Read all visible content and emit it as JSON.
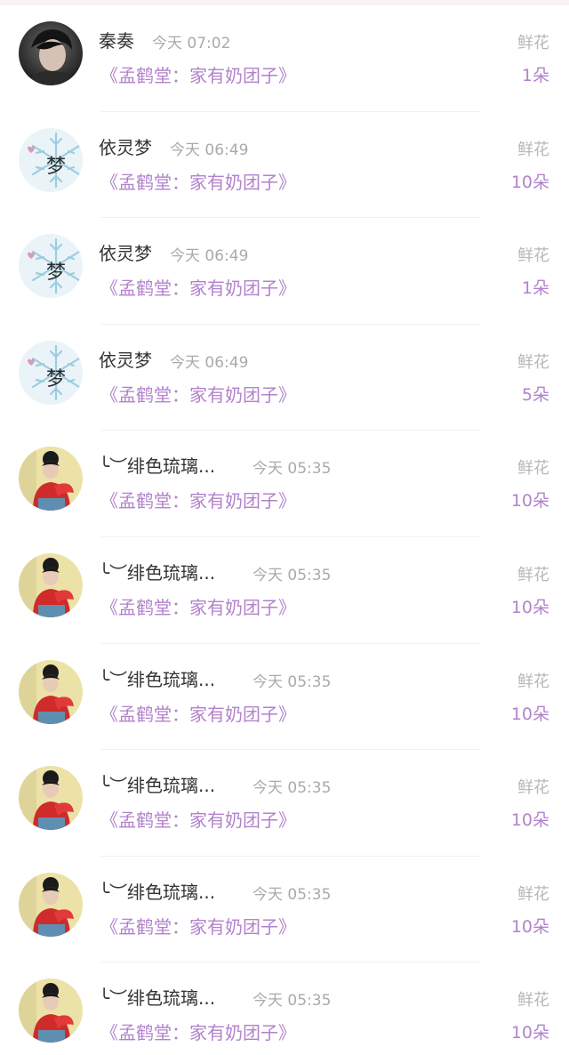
{
  "records": [
    {
      "user": "秦奏",
      "time": "今天 07:02",
      "book": "《孟鹤堂：家有奶团子》",
      "gift": "鲜花",
      "count": "1朵",
      "avatar": "photo-portrait"
    },
    {
      "user": "依灵梦",
      "time": "今天 06:49",
      "book": "《孟鹤堂：家有奶团子》",
      "gift": "鲜花",
      "count": "10朵",
      "avatar": "snowflake-meng"
    },
    {
      "user": "依灵梦",
      "time": "今天 06:49",
      "book": "《孟鹤堂：家有奶团子》",
      "gift": "鲜花",
      "count": "1朵",
      "avatar": "snowflake-meng"
    },
    {
      "user": "依灵梦",
      "time": "今天 06:49",
      "book": "《孟鹤堂：家有奶团子》",
      "gift": "鲜花",
      "count": "5朵",
      "avatar": "snowflake-meng"
    },
    {
      "user": "╰︶绯色琉璃...",
      "time": "今天 05:35",
      "book": "《孟鹤堂：家有奶团子》",
      "gift": "鲜花",
      "count": "10朵",
      "avatar": "girl-red"
    },
    {
      "user": "╰︶绯色琉璃...",
      "time": "今天 05:35",
      "book": "《孟鹤堂：家有奶团子》",
      "gift": "鲜花",
      "count": "10朵",
      "avatar": "girl-red"
    },
    {
      "user": "╰︶绯色琉璃...",
      "time": "今天 05:35",
      "book": "《孟鹤堂：家有奶团子》",
      "gift": "鲜花",
      "count": "10朵",
      "avatar": "girl-red"
    },
    {
      "user": "╰︶绯色琉璃...",
      "time": "今天 05:35",
      "book": "《孟鹤堂：家有奶团子》",
      "gift": "鲜花",
      "count": "10朵",
      "avatar": "girl-red"
    },
    {
      "user": "╰︶绯色琉璃...",
      "time": "今天 05:35",
      "book": "《孟鹤堂：家有奶团子》",
      "gift": "鲜花",
      "count": "10朵",
      "avatar": "girl-red"
    },
    {
      "user": "╰︶绯色琉璃...",
      "time": "今天 05:35",
      "book": "《孟鹤堂：家有奶团子》",
      "gift": "鲜花",
      "count": "10朵",
      "avatar": "girl-red"
    }
  ],
  "colors": {
    "accent": "#b282cc",
    "name": "#333333",
    "muted": "#aaaaaa",
    "gift": "#b7b7b7",
    "divider": "#f1f1f1",
    "topbar": "#fbf0f3"
  }
}
